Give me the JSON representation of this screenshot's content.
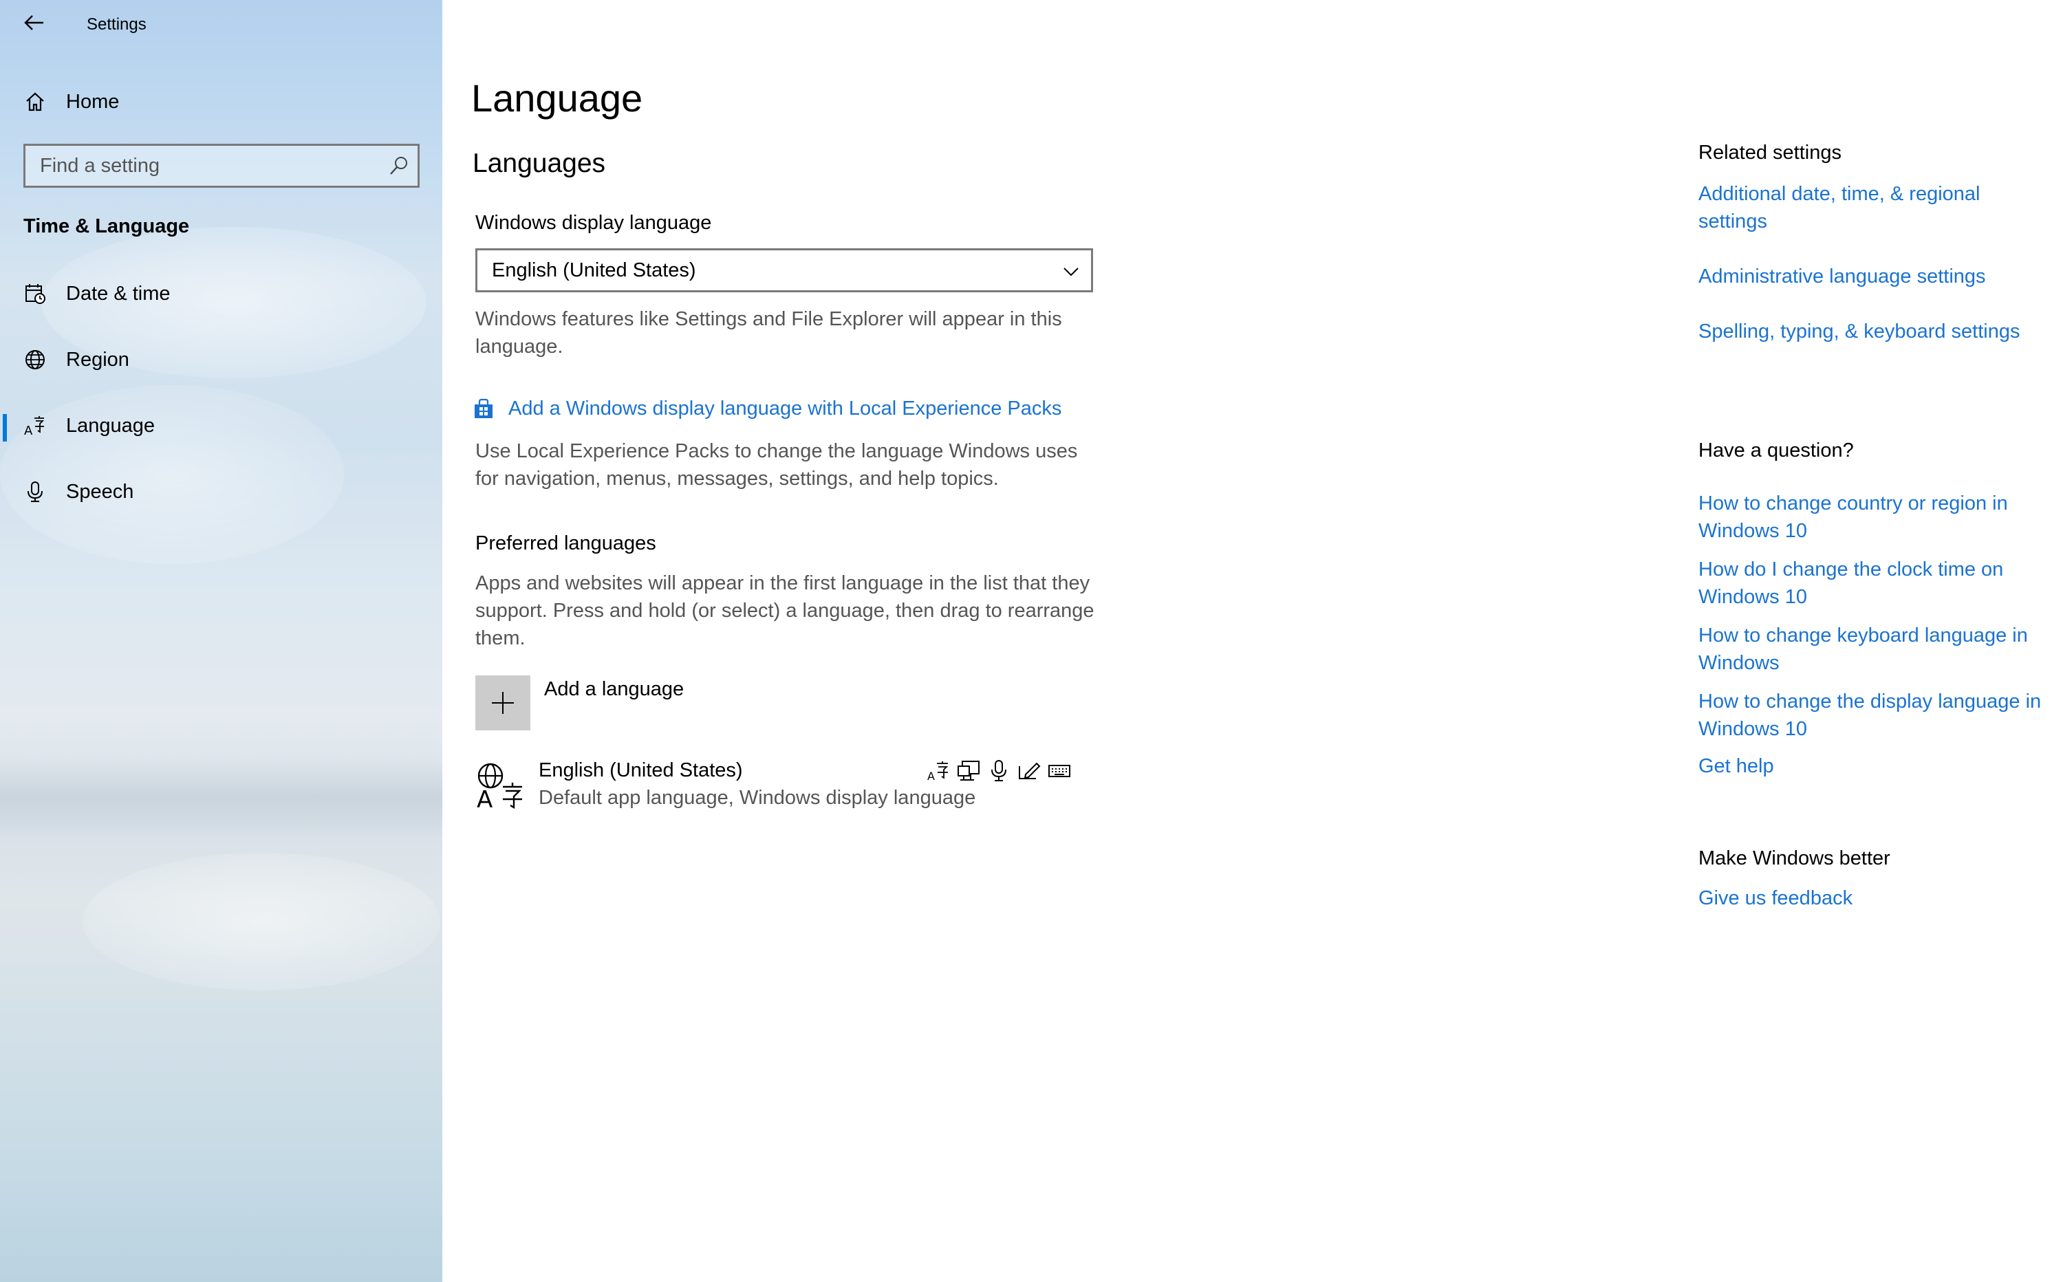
{
  "window": {
    "title": "Settings"
  },
  "sidebar": {
    "home_label": "Home",
    "search_placeholder": "Find a setting",
    "section_title": "Time & Language",
    "items": [
      {
        "label": "Date & time",
        "icon": "calendar-clock-icon"
      },
      {
        "label": "Region",
        "icon": "globe-icon"
      },
      {
        "label": "Language",
        "icon": "language-icon",
        "active": true
      },
      {
        "label": "Speech",
        "icon": "microphone-icon"
      }
    ]
  },
  "main": {
    "title": "Language",
    "languages_heading": "Languages",
    "display_language_label": "Windows display language",
    "display_language_value": "English (United States)",
    "display_language_desc": "Windows features like Settings and File Explorer will appear in this language.",
    "lxp_link": "Add a Windows display language with Local Experience Packs",
    "lxp_desc": "Use Local Experience Packs to change the language Windows uses for navigation, menus, messages, settings, and help topics.",
    "preferred_heading": "Preferred languages",
    "preferred_desc": "Apps and websites will appear in the first language in the list that they support. Press and hold (or select) a language, then drag to rearrange them.",
    "add_language_label": "Add a language",
    "installed_languages": [
      {
        "name": "English (United States)",
        "detail": "Default app language, Windows display language",
        "features": [
          "display-language-icon",
          "text-to-speech-icon",
          "speech-icon",
          "handwriting-icon",
          "keyboard-icon"
        ]
      }
    ]
  },
  "related": {
    "heading": "Related settings",
    "links": [
      "Additional date, time, & regional settings",
      "Administrative language settings",
      "Spelling, typing, & keyboard settings"
    ]
  },
  "question": {
    "heading": "Have a question?",
    "links": [
      "How to change country or region in Windows 10",
      "How do I change the clock time on Windows 10",
      "How to change keyboard language in Windows",
      "How to change the display language in Windows 10",
      "Get help"
    ]
  },
  "feedback": {
    "heading": "Make Windows better",
    "link": "Give us feedback"
  },
  "colors": {
    "accent": "#0078d7",
    "link": "#1a73d1"
  }
}
